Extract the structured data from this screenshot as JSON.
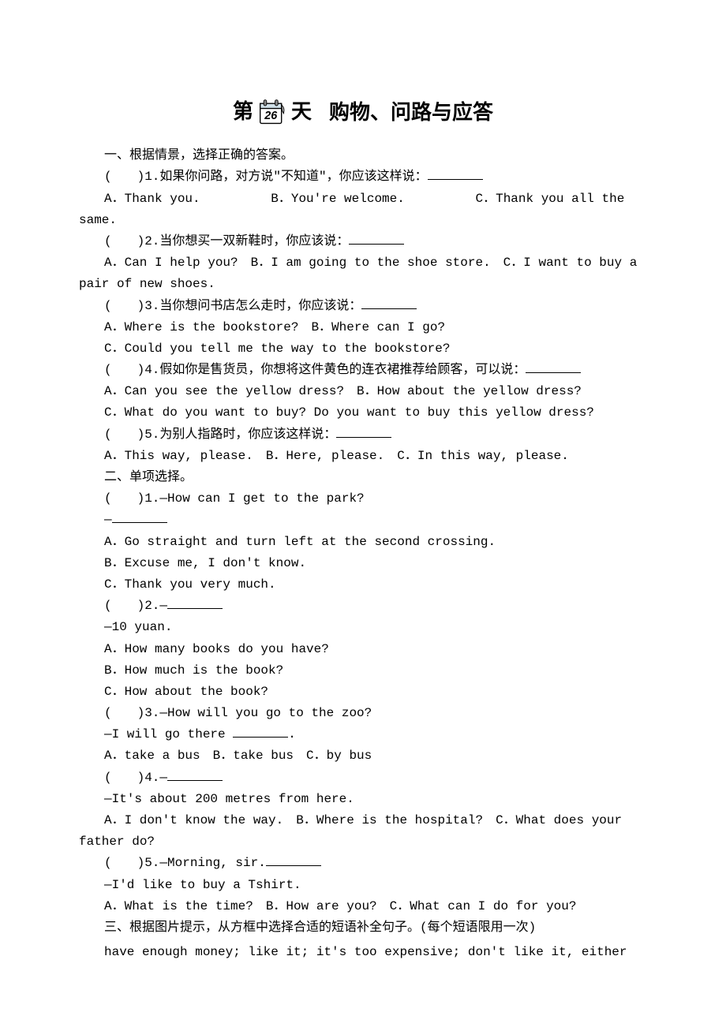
{
  "title": {
    "prefix": "第",
    "day": "26",
    "suffix": "天",
    "topic": "购物、问路与应答"
  },
  "section1": {
    "heading": "一、根据情景，选择正确的答案。",
    "q1": {
      "stem": "(　　)1.如果你问路，对方说\"不知道\"，你应该这样说：",
      "optA": "A．Thank you.",
      "optB": "B．You're welcome.",
      "optC": "C．Thank you all the same."
    },
    "q2": {
      "stem": "(　　)2.当你想买一双新鞋时，你应该说：",
      "opts": "A．Can I help you?　B．I am going to the shoe store.　C．I want to buy a pair of new shoes."
    },
    "q3": {
      "stem": "(　　)3.当你想问书店怎么走时，你应该说：",
      "line1": "A．Where is the bookstore?　B．Where can I go?",
      "line2": "C．Could you tell me the way to the bookstore?"
    },
    "q4": {
      "stem": "(　　)4.假如你是售货员，你想将这件黄色的连衣裙推荐给顾客，可以说：",
      "line1": "A．Can you see the yellow dress?　B．How about the yellow dress?",
      "line2": "C．What do you want to buy? Do you want to buy this yellow dress?"
    },
    "q5": {
      "stem": "(　　)5.为别人指路时，你应该这样说：",
      "opts": "A．This way, please.　B．Here, please.　C．In this way, please."
    }
  },
  "section2": {
    "heading": "二、单项选择。",
    "q1": {
      "stem": "(　　)1.—How can I get to the park?",
      "dash": "—",
      "a": "A．Go straight and turn left at the second crossing.",
      "b": "B．Excuse me, I don't know.",
      "c": "C．Thank you very much."
    },
    "q2": {
      "stem": "(　　)2.—",
      "reply": "—10 yuan.",
      "a": "A．How many books do you have?",
      "b": "B．How much is the book?",
      "c": "C．How about the book?"
    },
    "q3": {
      "stem": "(　　)3.—How will you go to the zoo?",
      "replyPre": "—I will go there ",
      "replyPost": ".",
      "opts": "A．take a bus　B．take bus　C．by bus"
    },
    "q4": {
      "stem": "(　　)4.—",
      "reply": "—It's about 200 metres from here.",
      "opts": "A．I don't know the way.　B．Where is the hospital?　C．What does your father do?"
    },
    "q5": {
      "stem": "(　　)5.—Morning, sir.",
      "reply": "—I'd like to buy a T­shirt.",
      "opts": "A．What is the time?　B．How are you?　C．What can I do for you?"
    }
  },
  "section3": {
    "heading": "三、根据图片提示，从方框中选择合适的短语补全句子。(每个短语限用一次)",
    "box": "have enough money; like it; it's too expensive; don't like it, either"
  }
}
